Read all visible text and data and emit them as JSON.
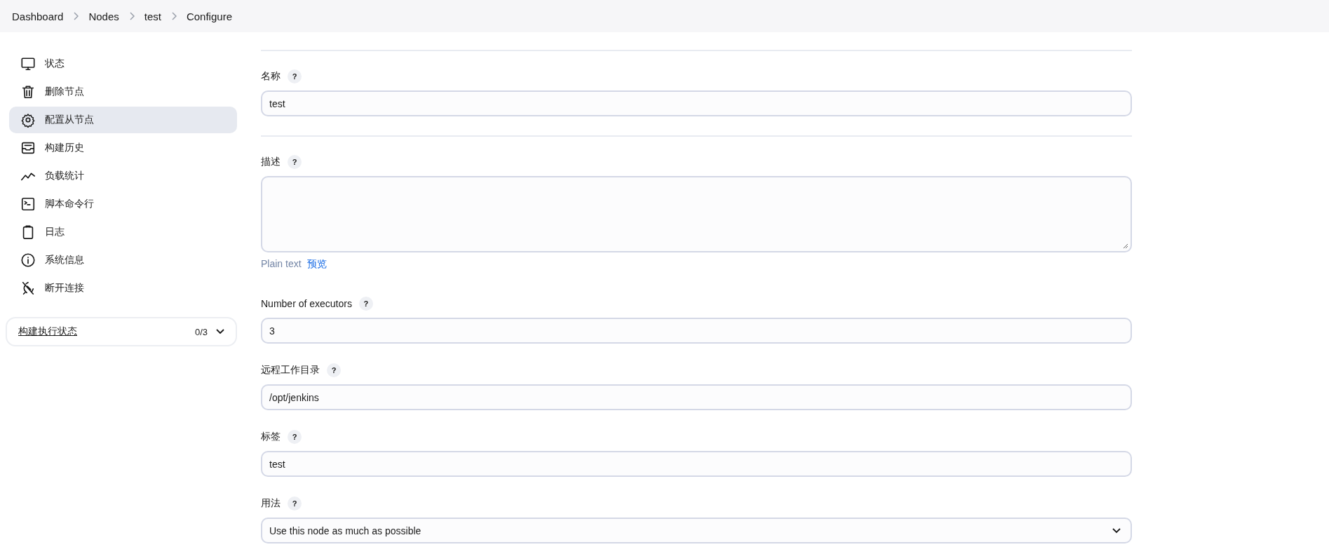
{
  "breadcrumbs": [
    "Dashboard",
    "Nodes",
    "test",
    "Configure"
  ],
  "sidebar": {
    "items": [
      {
        "label": "状态",
        "selected": false
      },
      {
        "label": "删除节点",
        "selected": false
      },
      {
        "label": "配置从节点",
        "selected": true
      },
      {
        "label": "构建历史",
        "selected": false
      },
      {
        "label": "负载统计",
        "selected": false
      },
      {
        "label": "脚本命令行",
        "selected": false
      },
      {
        "label": "日志",
        "selected": false
      },
      {
        "label": "系统信息",
        "selected": false
      },
      {
        "label": "断开连接",
        "selected": false
      }
    ],
    "executors": {
      "label": "构建执行状态",
      "count": "0/3",
      "expanded": false
    }
  },
  "form": [
    {
      "kind": "divider"
    },
    {
      "kind": "text",
      "label": "名称",
      "help": "?",
      "value": "test"
    },
    {
      "kind": "divider"
    },
    {
      "kind": "textarea",
      "label": "描述",
      "help": "?",
      "format": "Plain text",
      "preview": "预览"
    },
    {
      "kind": "text",
      "label": "Number of executors",
      "help": "?",
      "value": "3"
    },
    {
      "kind": "text",
      "label": "远程工作目录",
      "help": "?",
      "value": "/opt/jenkins"
    },
    {
      "kind": "text",
      "label": "标签",
      "help": "?",
      "value": "test"
    },
    {
      "kind": "select",
      "label": "用法",
      "help": "?",
      "value": "Use this node as much as possible"
    }
  ]
}
